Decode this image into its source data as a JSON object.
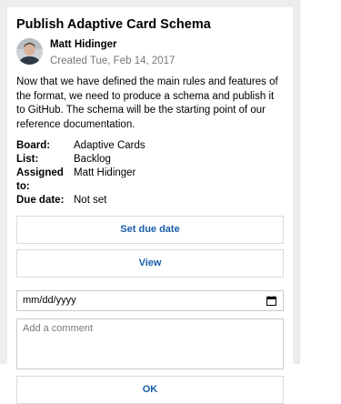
{
  "card": {
    "title": "Publish Adaptive Card Schema",
    "author": {
      "name": "Matt Hidinger",
      "created": "Created Tue, Feb 14, 2017",
      "avatar_icon": "person-avatar"
    },
    "description": "Now that we have defined the main rules and features of the format, we need to produce a schema and publish it to GitHub. The schema will be the starting point of our reference documentation.",
    "facts": [
      {
        "title": "Board:",
        "value": "Adaptive Cards"
      },
      {
        "title": "List:",
        "value": "Backlog"
      },
      {
        "title": "Assigned to:",
        "value": "Matt Hidinger"
      },
      {
        "title": "Due date:",
        "value": "Not set"
      }
    ],
    "actions": {
      "set_due_date": "Set due date",
      "view": "View"
    },
    "inputs": {
      "date_value": "mm/dd/yyyy",
      "comment_placeholder": "Add a comment",
      "ok_label": "OK"
    }
  },
  "colors": {
    "accent": "#1a5dac",
    "muted_text": "#767676",
    "frame_background": "#ecedef"
  }
}
